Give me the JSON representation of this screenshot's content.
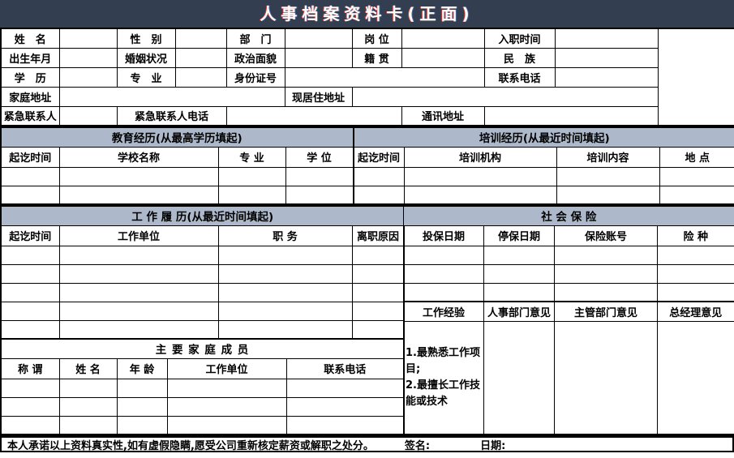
{
  "title": "人事档案资料卡(正面)",
  "fields": {
    "name": "姓　名",
    "gender": "性　别",
    "department": "部　门",
    "position": "岗 位",
    "hire_date": "入职时间",
    "birth_date": "出生年月",
    "marital_status": "婚姻状况",
    "political_status": "政治面貌",
    "native_place": "籍 贯",
    "ethnicity": "民　族",
    "education": "学　历",
    "major": "专　业",
    "id_number": "身份证号",
    "contact_phone": "联系电话",
    "home_address": "家庭地址",
    "current_address": "现居住地址",
    "emergency_contact": "紧急联系人",
    "emergency_phone": "紧急联系人电话",
    "mailing_address": "通讯地址"
  },
  "sections": {
    "education": {
      "title": "教育经历(从最高学历填起)",
      "headers": [
        "起讫时间",
        "学校名称",
        "专 业",
        "学 位"
      ]
    },
    "training": {
      "title": "培训经历(从最近时间填起)",
      "headers": [
        "起讫时间",
        "培训机构",
        "培训内容",
        "地 点"
      ]
    },
    "work": {
      "title": "工 作 履 历(从最近时间填起)",
      "headers": [
        "起讫时间",
        "工作单位",
        "职 务",
        "离职原因"
      ]
    },
    "insurance": {
      "title": "社 会 保 险",
      "headers": [
        "投保日期",
        "停保日期",
        "保险账号",
        "险 种"
      ]
    },
    "opinions": {
      "headers": [
        "工作经验",
        "人事部门意见",
        "主管部门意见",
        "总经理意见"
      ],
      "experience_note": "1.最熟悉工作项目;\n2.最擅长工作技能或技术"
    },
    "family": {
      "title": "主 要 家 庭 成 员",
      "headers": [
        "称 谓",
        "姓 名",
        "年 龄",
        "工作单位",
        "联系电话"
      ]
    }
  },
  "footer": {
    "pledge": "本人承诺以上资料真实性,如有虚假隐瞒,愿受公司重新核定薪资或解职之处分。",
    "signature_label": "签名:",
    "date_label": "日期:"
  }
}
